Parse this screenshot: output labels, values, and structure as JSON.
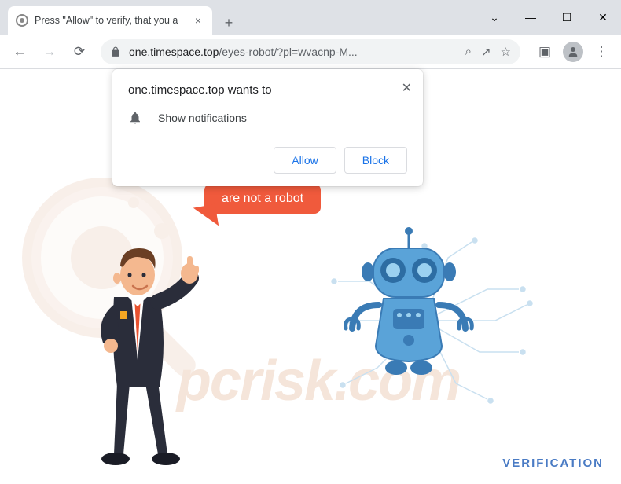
{
  "tab": {
    "title": "Press \"Allow\" to verify, that you a",
    "close": "×",
    "new_tab": "+"
  },
  "window": {
    "dropdown": "⌄",
    "minimize": "—",
    "maximize": "☐",
    "close": "✕"
  },
  "toolbar": {
    "back": "←",
    "forward": "→",
    "reload": "⟳",
    "search": "⌕",
    "share": "↗",
    "star": "☆",
    "panel": "▣",
    "menu": "⋮"
  },
  "url": {
    "domain": "one.timespace.top",
    "path": "/eyes-robot/?pl=wvacnp-M..."
  },
  "prompt": {
    "title": "one.timespace.top wants to",
    "permission": "Show notifications",
    "allow": "Allow",
    "block": "Block",
    "close": "✕"
  },
  "page": {
    "speech": "are not a robot",
    "verification": "VERIFICATION",
    "watermark": "pcrisk.com"
  }
}
